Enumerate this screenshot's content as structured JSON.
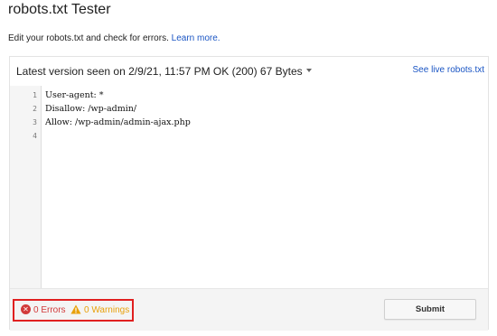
{
  "page": {
    "title": "robots.txt Tester",
    "description": "Edit your robots.txt and check for errors.",
    "learn_more_label": "Learn more."
  },
  "header": {
    "version_label": "Latest version seen on 2/9/21, 11:57 PM OK (200) 67 Bytes",
    "see_live_label": "See live robots.txt"
  },
  "editor": {
    "lines": [
      {
        "number": "1",
        "text": "User-agent: *"
      },
      {
        "number": "2",
        "text": "Disallow: /wp-admin/"
      },
      {
        "number": "3",
        "text": "Allow: /wp-admin/admin-ajax.php"
      },
      {
        "number": "4",
        "text": ""
      }
    ]
  },
  "footer": {
    "errors_label": "0 Errors",
    "warnings_label": "0 Warnings",
    "submit_label": "Submit"
  },
  "colors": {
    "link": "#1a55c4",
    "error": "#d23a3a",
    "warning": "#e8a10c",
    "highlight_border": "#e02020"
  },
  "icons": {
    "error": "error-circle-icon",
    "warning": "warning-triangle-icon",
    "dropdown": "caret-down-icon"
  }
}
